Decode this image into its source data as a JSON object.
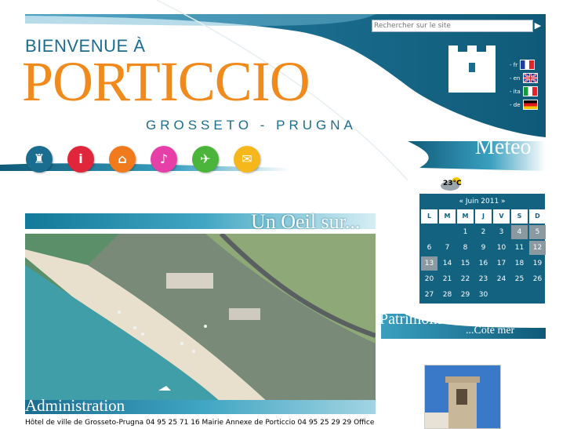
{
  "header": {
    "welcome": "BIENVENUE À",
    "town": "PORTICCIO",
    "subtitle": "GROSSETO - PRUGNA"
  },
  "search": {
    "placeholder": "Rechercher sur le site",
    "button_icon": "arrow-right-icon"
  },
  "languages": [
    {
      "label": "- fr",
      "flag": "france-flag-icon"
    },
    {
      "label": "- en",
      "flag": "uk-flag-icon"
    },
    {
      "label": "- ita",
      "flag": "italy-flag-icon"
    },
    {
      "label": "- de",
      "flag": "germany-flag-icon"
    }
  ],
  "nav_icons": [
    {
      "name": "tower-icon",
      "color": "#1b6d8f"
    },
    {
      "name": "info-icon",
      "color": "#e0263a"
    },
    {
      "name": "house-icon",
      "color": "#f07a1c"
    },
    {
      "name": "music-icon",
      "color": "#e63fa8"
    },
    {
      "name": "map-icon",
      "color": "#4bb43a"
    },
    {
      "name": "mail-icon",
      "color": "#f5b71c"
    }
  ],
  "meteo": {
    "label": "Météo",
    "temperature": "23°C",
    "icon": "partly-cloudy-icon"
  },
  "sections": {
    "oeil": "Un Oeil sur...",
    "admin": "Administration",
    "admin_text": "Hôtel de ville de Grosseto-Prugna 04 95 25 71 16 Mairie Annexe de Porticcio 04 95 25 29 29 Office",
    "patrimoine": "Patrimoine...",
    "cote_mer": "...Côté mer"
  },
  "calendar": {
    "title": "« Juin 2011 »",
    "day_headers": [
      "L",
      "M",
      "M",
      "J",
      "V",
      "S",
      "D"
    ],
    "weeks": [
      [
        "",
        "",
        "1",
        "2",
        "3",
        "4",
        "5"
      ],
      [
        "6",
        "7",
        "8",
        "9",
        "10",
        "11",
        "12"
      ],
      [
        "13",
        "14",
        "15",
        "16",
        "17",
        "18",
        "19"
      ],
      [
        "20",
        "21",
        "22",
        "23",
        "24",
        "25",
        "26"
      ],
      [
        "27",
        "28",
        "29",
        "30",
        "",
        "",
        ""
      ]
    ],
    "highlighted_days": [
      "4",
      "5",
      "12",
      "13"
    ],
    "accent_color": "#13627f"
  },
  "colors": {
    "brand_blue": "#1b6d8f",
    "brand_orange": "#f08a1c"
  }
}
